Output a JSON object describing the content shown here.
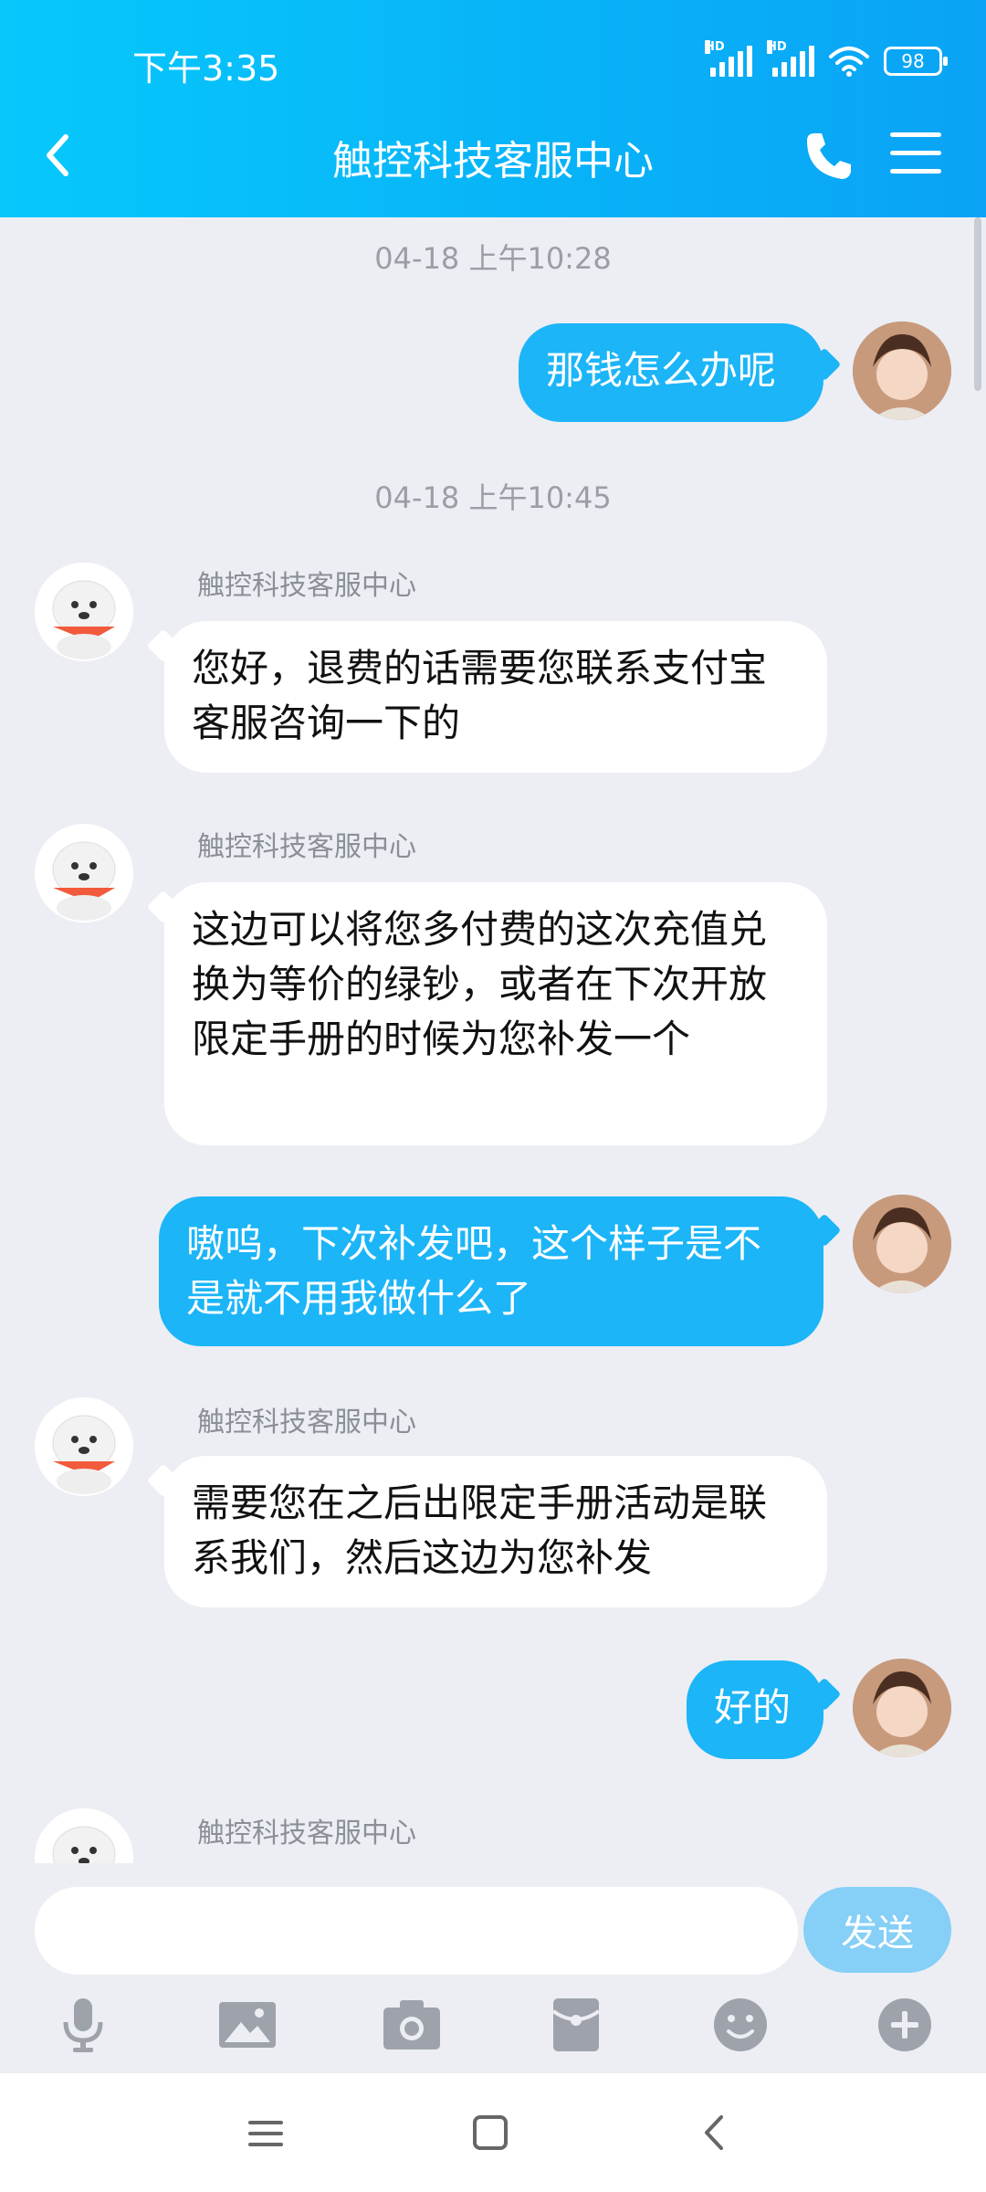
{
  "status_bar": {
    "time": "下午3:35",
    "battery": "98",
    "signal_label": "HD"
  },
  "header": {
    "title": "触控科技客服中心"
  },
  "messages": [
    {
      "type": "timestamp",
      "text": "04-18 上午10:28"
    },
    {
      "type": "out",
      "text": "那钱怎么办呢"
    },
    {
      "type": "timestamp",
      "text": "04-18 上午10:45"
    },
    {
      "type": "in",
      "sender": "触控科技客服中心",
      "text": "您好，退费的话需要您联系支付宝客服咨询一下的"
    },
    {
      "type": "in",
      "sender": "触控科技客服中心",
      "text": "这边可以将您多付费的这次充值兑换为等价的绿钞，或者在下次开放限定手册的时候为您补发一个"
    },
    {
      "type": "out",
      "text": "嗷呜，下次补发吧，这个样子是不是就不用我做什么了"
    },
    {
      "type": "in",
      "sender": "触控科技客服中心",
      "text": "需要您在之后出限定手册活动是联系我们，然后这边为您补发"
    },
    {
      "type": "out",
      "text": "好的"
    },
    {
      "type": "in",
      "sender": "触控科技客服中心",
      "text": ""
    }
  ],
  "input": {
    "placeholder": "",
    "send_label": "发送"
  },
  "toolbar": [
    "microphone-icon",
    "image-icon",
    "camera-icon",
    "red-packet-icon",
    "emoji-icon",
    "plus-icon"
  ],
  "nav": [
    "menu-icon",
    "home-icon",
    "back-icon"
  ],
  "colors": {
    "header_start": "#06c8fb",
    "header_end": "#0aa3f5",
    "out_bubble": "#1cb5f7",
    "send_button": "#86cff6",
    "background": "#eceef4"
  }
}
